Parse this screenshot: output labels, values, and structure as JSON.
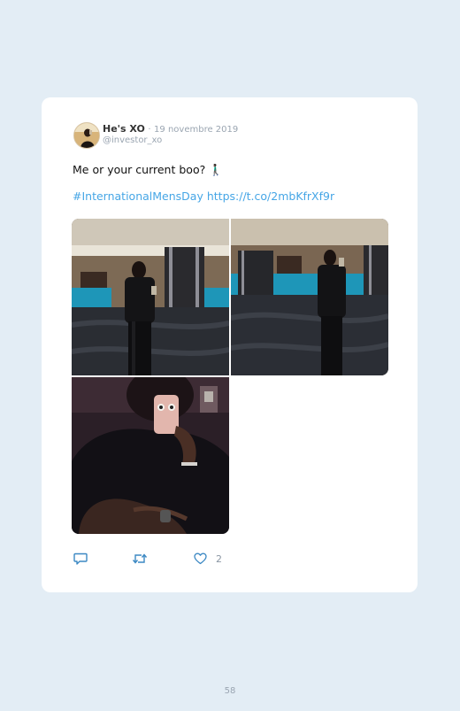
{
  "tweet": {
    "display_name": "He's XO",
    "separator": "·",
    "date": "19 novembre 2019",
    "handle": "@investor_xo",
    "text": "Me or your current boo? 🚶🏿‍♂️",
    "hashtag": "#InternationalMensDay",
    "link": "https://t.co/2mbKfrXf9r",
    "like_count": "2"
  },
  "icons": {
    "reply": "reply-icon",
    "retweet": "retweet-icon",
    "like": "heart-icon"
  },
  "colors": {
    "page_background": "#e3edf5",
    "card_background": "#ffffff",
    "link": "#46a6e6",
    "muted": "#9aa5b1",
    "action_icon": "#3b88c3"
  },
  "page": {
    "number": "58"
  }
}
